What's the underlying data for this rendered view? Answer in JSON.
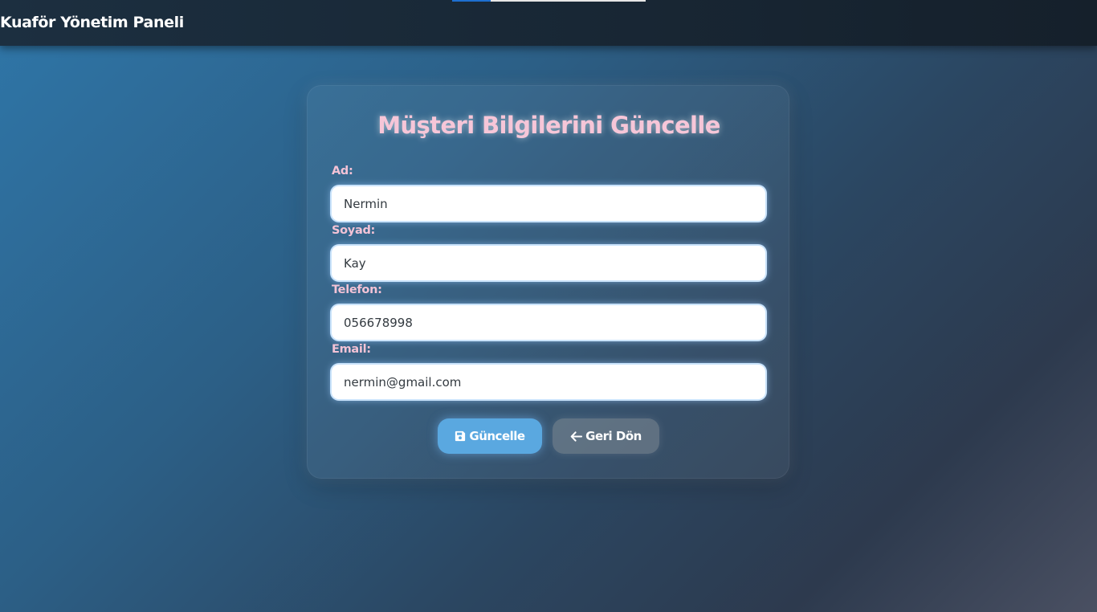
{
  "navbar": {
    "brand": "Kuaför Yönetim Paneli"
  },
  "form": {
    "title": "Müşteri Bilgilerini Güncelle",
    "fields": [
      {
        "label": "Ad:",
        "value": "Nermin"
      },
      {
        "label": "Soyad:",
        "value": "Kay"
      },
      {
        "label": "Telefon:",
        "value": "056678998"
      },
      {
        "label": "Email:",
        "value": "nermin@gmail.com"
      }
    ],
    "buttons": {
      "update_label": "Güncelle",
      "update_icon": "floppy-disk-icon",
      "back_label": "Geri Dön",
      "back_icon": "arrow-left-icon"
    }
  },
  "colors": {
    "title_pink": "#f6c6d8",
    "primary_button": "#5aa8e0",
    "navbar": "#15202b"
  }
}
